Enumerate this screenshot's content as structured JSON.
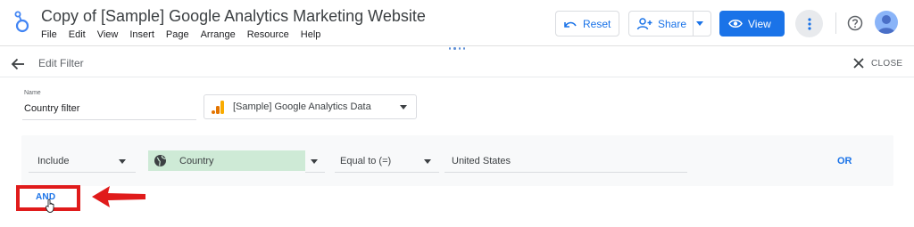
{
  "app": {
    "title": "Copy of [Sample] Google Analytics Marketing Website",
    "menu": [
      "File",
      "Edit",
      "View",
      "Insert",
      "Page",
      "Arrange",
      "Resource",
      "Help"
    ],
    "buttons": {
      "reset": "Reset",
      "share": "Share",
      "view": "View"
    }
  },
  "filter_editor": {
    "header_title": "Edit Filter",
    "close_label": "CLOSE",
    "name_label": "Name",
    "name_value": "Country filter",
    "data_source": "[Sample] Google Analytics Data",
    "clause": {
      "include_mode": "Include",
      "dimension": "Country",
      "operator": "Equal to (=)",
      "value": "United States",
      "or_label": "OR"
    },
    "and_label": "AND"
  },
  "colors": {
    "accent": "#1a73e8",
    "dimension_chip": "#ceead6",
    "annotation_red": "#e01b1b"
  },
  "icons": {
    "app_logo": "data-studio-logo-icon",
    "reset": "undo-icon",
    "share": "add-person-icon",
    "view": "eye-icon",
    "more": "more-vert-icon",
    "help": "help-icon",
    "back": "arrow-back-icon",
    "close": "close-icon",
    "data_source": "analytics-icon",
    "dimension": "globe-icon"
  }
}
